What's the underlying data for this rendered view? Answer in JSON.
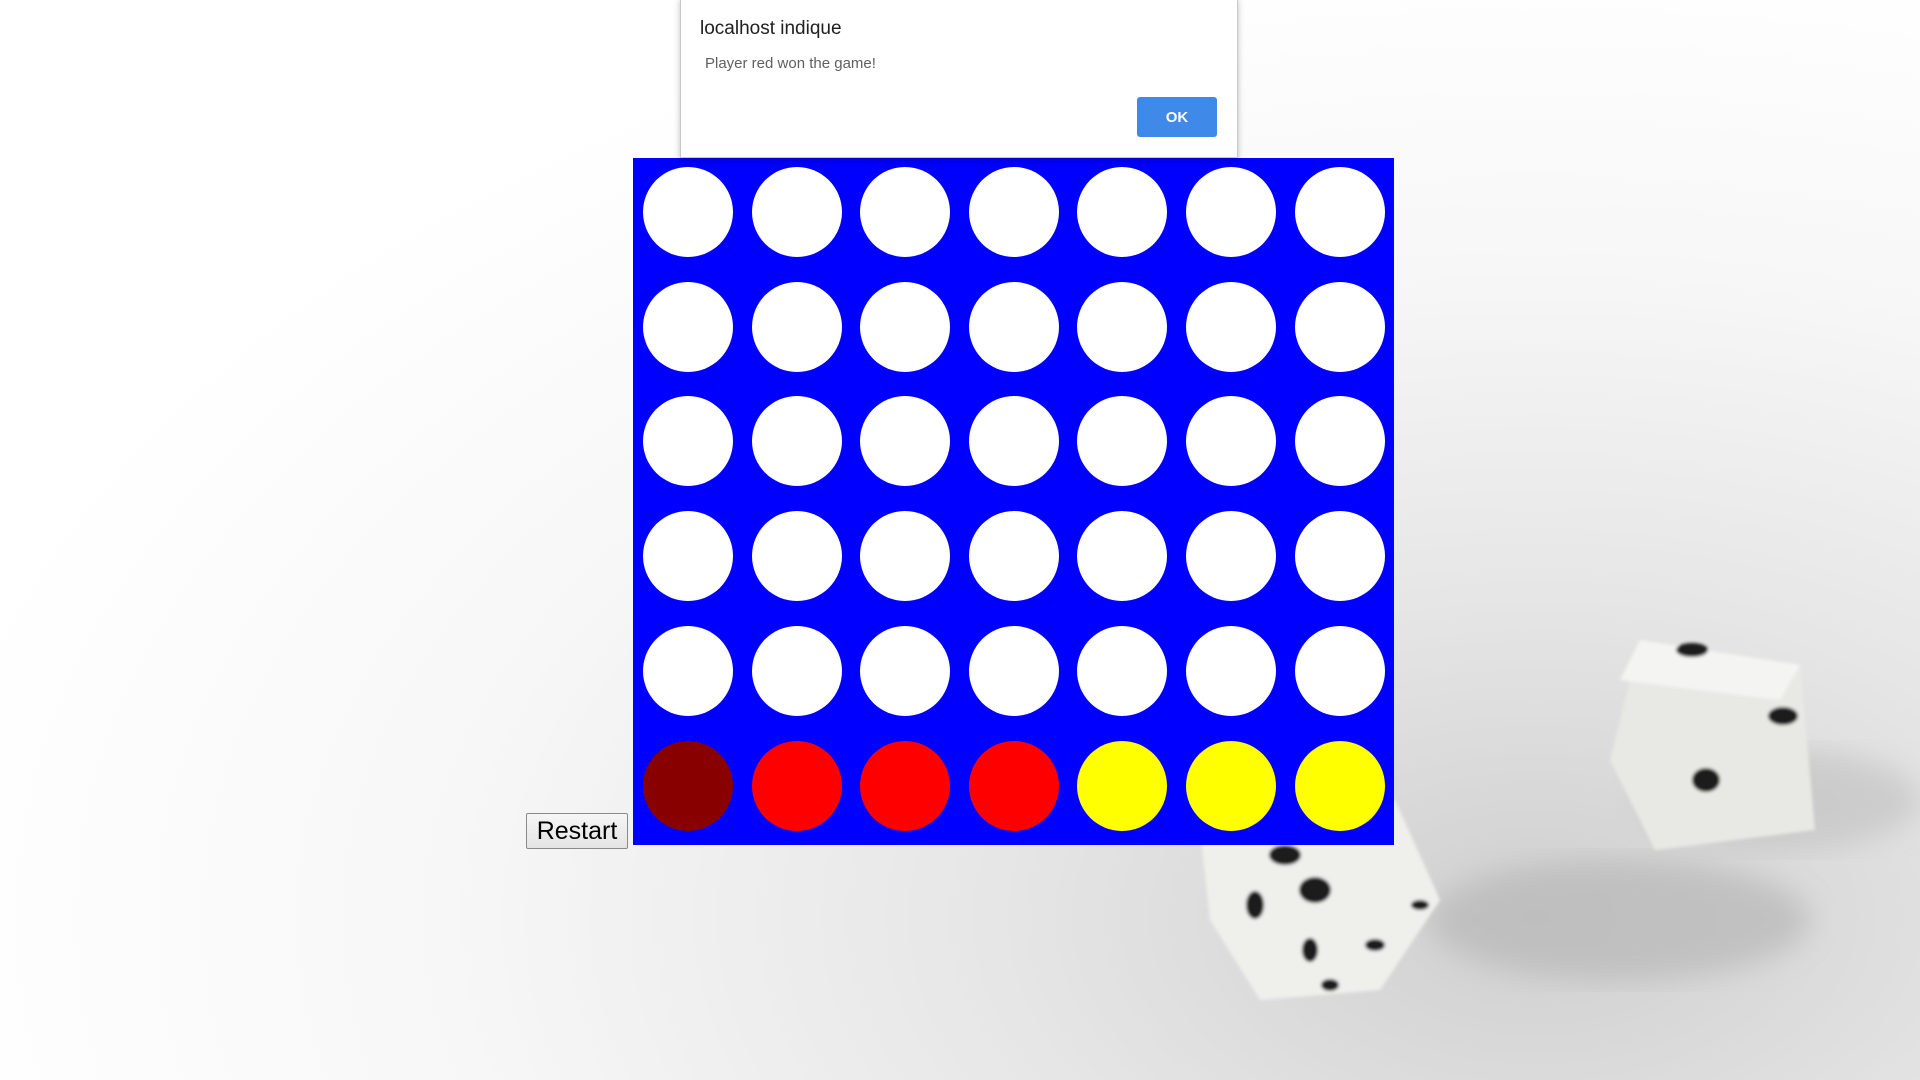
{
  "dialog": {
    "title": "localhost indique",
    "message": "Player red won the game!",
    "ok_label": "OK"
  },
  "controls": {
    "restart_label": "Restart"
  },
  "board": {
    "columns": 7,
    "rows": 6,
    "grid": [
      [
        "empty",
        "empty",
        "empty",
        "empty",
        "empty",
        "empty",
        "empty"
      ],
      [
        "empty",
        "empty",
        "empty",
        "empty",
        "empty",
        "empty",
        "empty"
      ],
      [
        "empty",
        "empty",
        "empty",
        "empty",
        "empty",
        "empty",
        "empty"
      ],
      [
        "empty",
        "empty",
        "empty",
        "empty",
        "empty",
        "empty",
        "empty"
      ],
      [
        "empty",
        "empty",
        "empty",
        "empty",
        "empty",
        "empty",
        "empty"
      ],
      [
        "dark-red",
        "red",
        "red",
        "red",
        "yellow",
        "yellow",
        "yellow"
      ]
    ]
  },
  "colors": {
    "board": "#0000ff",
    "empty": "#ffffff",
    "red": "#ff0000",
    "dark-red": "#880000",
    "yellow": "#ffff00",
    "ok_button": "#3f89e8"
  }
}
